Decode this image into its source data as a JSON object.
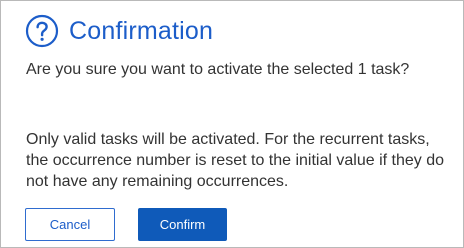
{
  "dialog": {
    "title": "Confirmation",
    "icon": "help-circle-icon",
    "message_primary": "Are you sure you want to activate the selected 1 task?",
    "message_secondary": "Only valid tasks will be activated. For the recurrent tasks, the occurrence number is reset to the initial value if they do not have any remaining occurrences.",
    "cancel_label": "Cancel",
    "confirm_label": "Confirm"
  },
  "colors": {
    "accent": "#1c5dc9",
    "primary_button": "#0f5ab9",
    "text": "#333333",
    "border": "#b9b9b9"
  }
}
